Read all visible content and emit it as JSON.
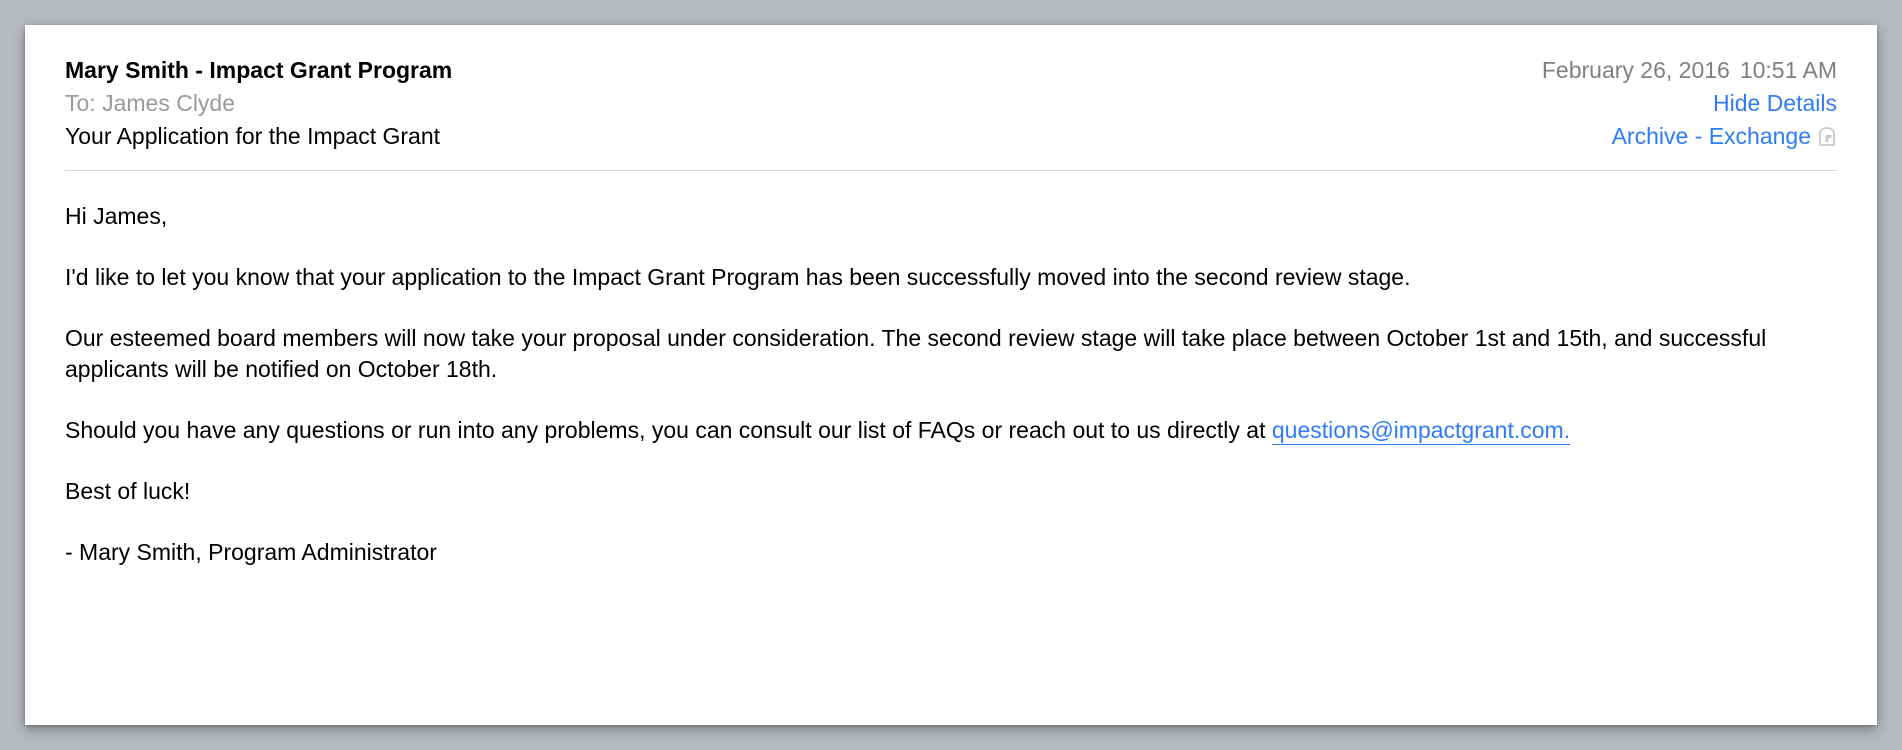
{
  "header": {
    "from": "Mary Smith - Impact Grant Program",
    "to_prefix": "To: ",
    "to_name": "James Clyde",
    "subject": "Your Application for the Impact Grant",
    "date": "February 26, 2016",
    "time": "10:51 AM",
    "hide_details": "Hide Details",
    "archive_label": "Archive - Exchange"
  },
  "body": {
    "greeting": "Hi James,",
    "p1": "I'd like to let you know that your application to the Impact Grant Program has been successfully moved into the second review stage.",
    "p2": "Our esteemed board members will now take your proposal under consideration. The second review stage will take place between October 1st and 15th, and successful applicants will be notified on October 18th.",
    "p3_before_link": "Should you have any questions or run into any problems, you can consult our list of FAQs or reach out to us directly at ",
    "p3_link": "questions@impactgrant.com.",
    "closing": "Best of luck!",
    "signature": "- Mary Smith, Program Administrator"
  }
}
